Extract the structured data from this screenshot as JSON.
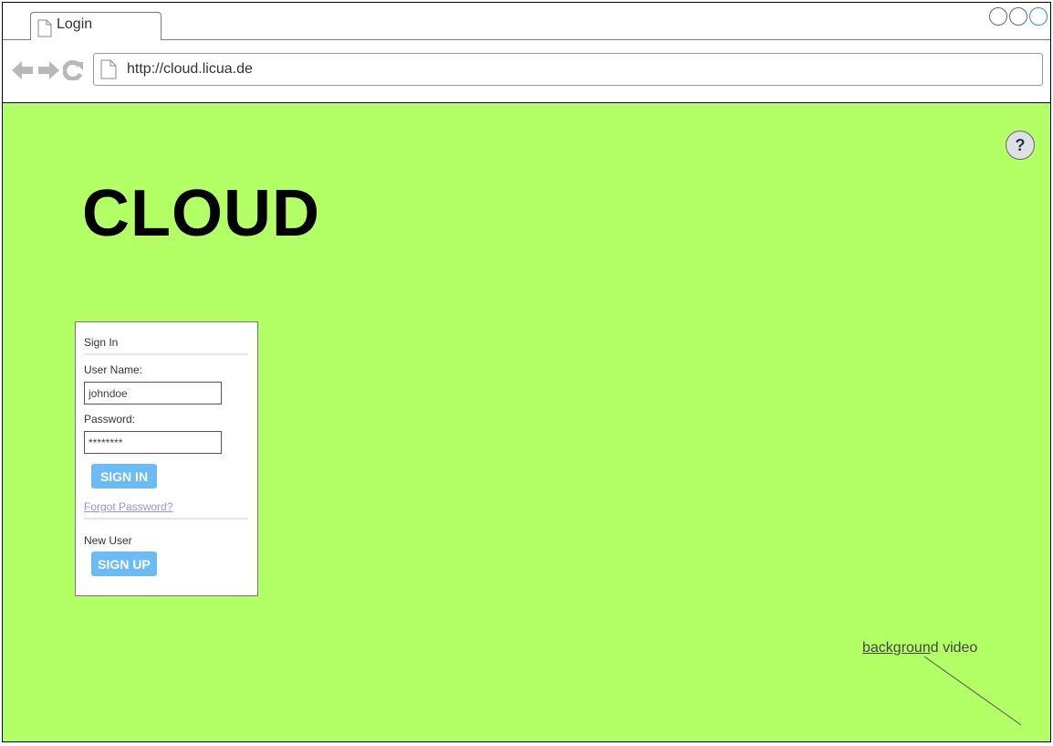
{
  "browser": {
    "tab_title": "Login",
    "url": "http://cloud.licua.de"
  },
  "page": {
    "brand": "CLOUD",
    "help_label": "?",
    "background_color": "#b3ff66"
  },
  "signin": {
    "heading": "Sign In",
    "username_label": "User Name:",
    "username_value": "johndoe",
    "password_label": "Password:",
    "password_value": "********",
    "signin_button": "SIGN IN",
    "forgot_link": "Forgot Password?",
    "new_user_label": "New User",
    "signup_button": "SIGN UP"
  },
  "annotation": {
    "underlined": "backgroun",
    "rest": "d video"
  },
  "colors": {
    "accent_button": "#6bbcf5",
    "link": "#8e95e8",
    "active_window_button": "#2a8be6"
  },
  "icons": [
    "page-icon",
    "back-arrow-icon",
    "forward-arrow-icon",
    "refresh-icon",
    "help-icon"
  ]
}
